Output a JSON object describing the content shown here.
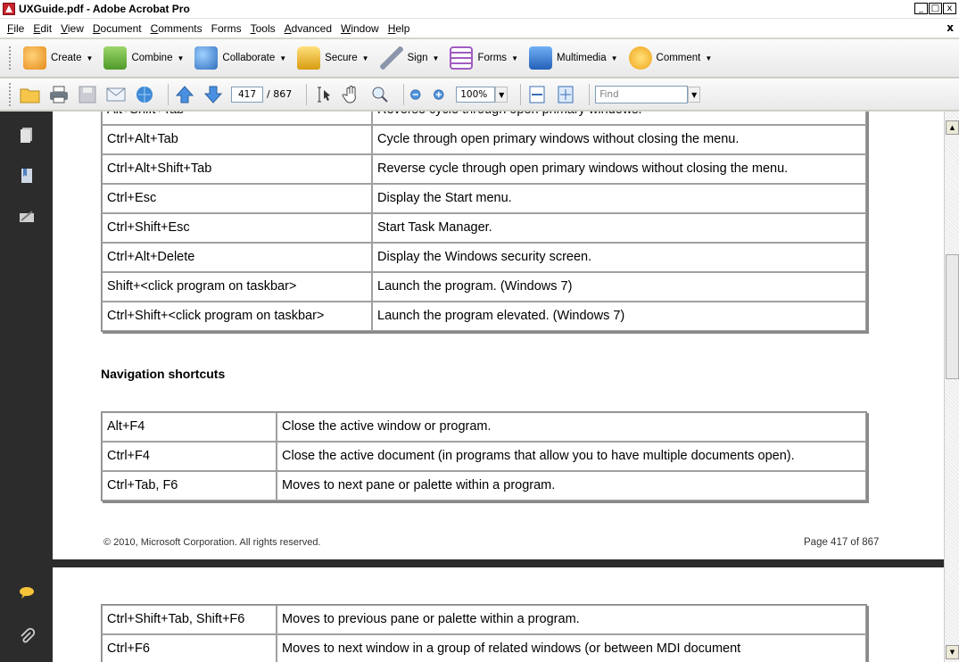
{
  "window": {
    "title": "UXGuide.pdf - Adobe Acrobat Pro",
    "controls": [
      "_",
      "□",
      "x"
    ],
    "doc_close": "x"
  },
  "menubar": {
    "items": [
      {
        "u": "F",
        "rest": "ile"
      },
      {
        "u": "E",
        "rest": "dit"
      },
      {
        "u": "V",
        "rest": "iew"
      },
      {
        "u": "D",
        "rest": "ocument"
      },
      {
        "u": "C",
        "rest": "omments"
      },
      {
        "u": "",
        "rest": "Forms"
      },
      {
        "u": "T",
        "rest": "ools"
      },
      {
        "u": "A",
        "rest": "dvanced"
      },
      {
        "u": "W",
        "rest": "indow"
      },
      {
        "u": "H",
        "rest": "elp"
      }
    ]
  },
  "tasks": [
    {
      "label": "Create",
      "icon": "create-icon",
      "color": "#f2a73b"
    },
    {
      "label": "Combine",
      "icon": "combine-icon",
      "color": "#7ab648"
    },
    {
      "label": "Collaborate",
      "icon": "collaborate-icon",
      "color": "#4a8fd4"
    },
    {
      "label": "Secure",
      "icon": "lock-icon",
      "color": "#e6b422"
    },
    {
      "label": "Sign",
      "icon": "pen-icon",
      "color": "#9aa6b8"
    },
    {
      "label": "Forms",
      "icon": "forms-icon",
      "color": "#a05cc0"
    },
    {
      "label": "Multimedia",
      "icon": "multimedia-icon",
      "color": "#3b7dd8"
    },
    {
      "label": "Comment",
      "icon": "comment-icon",
      "color": "#f3c33a"
    }
  ],
  "nav": {
    "page_current": "417",
    "page_total": "/ 867",
    "zoom": "100%",
    "find_placeholder": "Find"
  },
  "doc": {
    "table1": [
      [
        "Alt+Shift+Tab",
        "Reverse cycle through open primary windows."
      ],
      [
        "Ctrl+Alt+Tab",
        "Cycle through open primary windows without closing the menu."
      ],
      [
        "Ctrl+Alt+Shift+Tab",
        "Reverse cycle through open primary windows without closing the menu."
      ],
      [
        "Ctrl+Esc",
        "Display the Start menu."
      ],
      [
        "Ctrl+Shift+Esc",
        "Start Task Manager."
      ],
      [
        "Ctrl+Alt+Delete",
        "Display the Windows security screen."
      ],
      [
        "Shift+<click program on taskbar>",
        "Launch the program. (Windows 7)"
      ],
      [
        "Ctrl+Shift+<click program on taskbar>",
        "Launch the program elevated. (Windows 7)"
      ]
    ],
    "section_heading": "Navigation shortcuts",
    "table2": [
      [
        "Alt+F4",
        "Close the active window or program."
      ],
      [
        "Ctrl+F4",
        "Close the active document (in programs that allow you to have multiple documents open)."
      ],
      [
        "Ctrl+Tab, F6",
        "Moves to next pane or palette within a program."
      ]
    ],
    "footer_left": "© 2010, Microsoft Corporation. All rights reserved.",
    "footer_right": "Page 417 of 867",
    "table3": [
      [
        "Ctrl+Shift+Tab, Shift+F6",
        "Moves to previous pane or palette within a program."
      ],
      [
        "Ctrl+F6",
        "Moves to next window in a group of related windows (or between MDI document"
      ]
    ]
  }
}
